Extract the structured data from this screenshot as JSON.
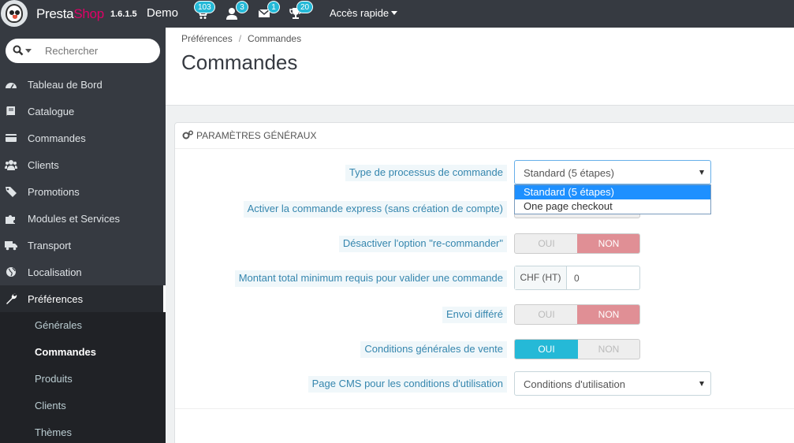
{
  "header": {
    "brand_presta": "Presta",
    "brand_shop": "Shop",
    "version": "1.6.1.5",
    "shop_name": "Demo",
    "badges": {
      "orders": "103",
      "customers": "3",
      "messages": "1",
      "achievements": "20"
    },
    "quick_access": "Accès rapide"
  },
  "sidebar": {
    "search_placeholder": "Rechercher",
    "items": [
      {
        "label": "Tableau de Bord",
        "icon": "dashboard-icon"
      },
      {
        "label": "Catalogue",
        "icon": "book-icon"
      },
      {
        "label": "Commandes",
        "icon": "credit-card-icon"
      },
      {
        "label": "Clients",
        "icon": "users-icon"
      },
      {
        "label": "Promotions",
        "icon": "tag-icon"
      },
      {
        "label": "Modules et Services",
        "icon": "puzzle-icon"
      },
      {
        "label": "Transport",
        "icon": "truck-icon"
      },
      {
        "label": "Localisation",
        "icon": "globe-icon"
      },
      {
        "label": "Préférences",
        "icon": "wrench-icon"
      }
    ],
    "submenu": [
      "Générales",
      "Commandes",
      "Produits",
      "Clients",
      "Thèmes"
    ]
  },
  "breadcrumb": {
    "parent": "Préférences",
    "separator": "/",
    "current": "Commandes"
  },
  "page_title": "Commandes",
  "panel": {
    "title": "Paramètres généraux",
    "fields": {
      "process_type": {
        "label": "Type de processus de commande",
        "value": "Standard (5 étapes)",
        "options": [
          "Standard (5 étapes)",
          "One page checkout"
        ]
      },
      "express": {
        "label": "Activer la commande express (sans création de compte)"
      },
      "reorder": {
        "label": "Désactiver l'option \"re-commander\"",
        "on": "OUI",
        "off": "NON",
        "value": "NON"
      },
      "min_amount": {
        "label": "Montant total minimum requis pour valider une commande",
        "currency": "CHF (HT)",
        "value": "0"
      },
      "deferred": {
        "label": "Envoi différé",
        "on": "OUI",
        "off": "NON",
        "value": "NON"
      },
      "terms": {
        "label": "Conditions générales de vente",
        "on": "OUI",
        "off": "NON",
        "value": "OUI"
      },
      "cms_page": {
        "label": "Page CMS pour les conditions d'utilisation",
        "value": "Conditions d'utilisation"
      }
    }
  },
  "colors": {
    "sidebar": "#363a41",
    "accent": "#25b9d7",
    "non_active": "#e08f95",
    "label": "#3586ae",
    "brand_pink": "#df0067"
  }
}
